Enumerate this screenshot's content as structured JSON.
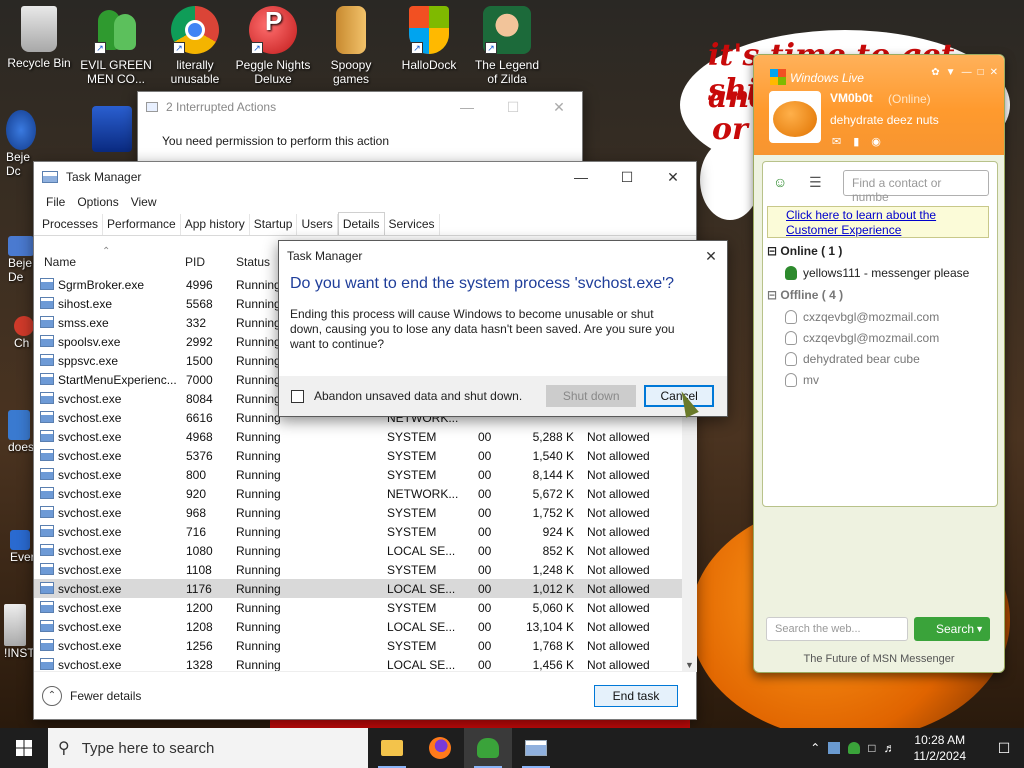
{
  "desktop": {
    "icons": [
      {
        "label": "Recycle Bin"
      },
      {
        "label": "EVIL GREEN MEN CO..."
      },
      {
        "label": "literally unusable"
      },
      {
        "label": "Peggle Nights Deluxe"
      },
      {
        "label": "Spoopy games"
      },
      {
        "label": "HalloDock"
      },
      {
        "label": "The Legend of Zilda"
      }
    ],
    "partial_labels": [
      "Beje Dc",
      "Beje De",
      "Ch De",
      "does",
      "Ever",
      "!INST"
    ],
    "wallpaper_text": [
      "it's time to get shit",
      "and",
      "or t"
    ]
  },
  "interrupted": {
    "title": "2 Interrupted Actions",
    "message": "You need permission to perform this action"
  },
  "taskmgr": {
    "title": "Task Manager",
    "menu": [
      "File",
      "Options",
      "View"
    ],
    "tabs": [
      "Processes",
      "Performance",
      "App history",
      "Startup",
      "Users",
      "Details",
      "Services"
    ],
    "active_tab": "Details",
    "columns": {
      "name": "Name",
      "pid": "PID",
      "status": "Status"
    },
    "rows": [
      {
        "name": "SgrmBroker.exe",
        "pid": "4996",
        "status": "Running",
        "user": "",
        "cpu": "",
        "mem": "",
        "uac": ""
      },
      {
        "name": "sihost.exe",
        "pid": "5568",
        "status": "Running",
        "user": "",
        "cpu": "",
        "mem": "",
        "uac": ""
      },
      {
        "name": "smss.exe",
        "pid": "332",
        "status": "Running",
        "user": "",
        "cpu": "",
        "mem": "",
        "uac": ""
      },
      {
        "name": "spoolsv.exe",
        "pid": "2992",
        "status": "Running",
        "user": "",
        "cpu": "",
        "mem": "",
        "uac": ""
      },
      {
        "name": "sppsvc.exe",
        "pid": "1500",
        "status": "Running",
        "user": "",
        "cpu": "",
        "mem": "",
        "uac": ""
      },
      {
        "name": "StartMenuExperienc...",
        "pid": "7000",
        "status": "Running",
        "user": "",
        "cpu": "",
        "mem": "",
        "uac": ""
      },
      {
        "name": "svchost.exe",
        "pid": "8084",
        "status": "Running",
        "user": "",
        "cpu": "",
        "mem": "",
        "uac": ""
      },
      {
        "name": "svchost.exe",
        "pid": "6616",
        "status": "Running",
        "user": "NETWORK...",
        "cpu": "",
        "mem": "",
        "uac": ""
      },
      {
        "name": "svchost.exe",
        "pid": "4968",
        "status": "Running",
        "user": "SYSTEM",
        "cpu": "00",
        "mem": "5,288 K",
        "uac": "Not allowed"
      },
      {
        "name": "svchost.exe",
        "pid": "5376",
        "status": "Running",
        "user": "SYSTEM",
        "cpu": "00",
        "mem": "1,540 K",
        "uac": "Not allowed"
      },
      {
        "name": "svchost.exe",
        "pid": "800",
        "status": "Running",
        "user": "SYSTEM",
        "cpu": "00",
        "mem": "8,144 K",
        "uac": "Not allowed"
      },
      {
        "name": "svchost.exe",
        "pid": "920",
        "status": "Running",
        "user": "NETWORK...",
        "cpu": "00",
        "mem": "5,672 K",
        "uac": "Not allowed"
      },
      {
        "name": "svchost.exe",
        "pid": "968",
        "status": "Running",
        "user": "SYSTEM",
        "cpu": "00",
        "mem": "1,752 K",
        "uac": "Not allowed"
      },
      {
        "name": "svchost.exe",
        "pid": "716",
        "status": "Running",
        "user": "SYSTEM",
        "cpu": "00",
        "mem": "924 K",
        "uac": "Not allowed"
      },
      {
        "name": "svchost.exe",
        "pid": "1080",
        "status": "Running",
        "user": "LOCAL SE...",
        "cpu": "00",
        "mem": "852 K",
        "uac": "Not allowed"
      },
      {
        "name": "svchost.exe",
        "pid": "1108",
        "status": "Running",
        "user": "SYSTEM",
        "cpu": "00",
        "mem": "1,248 K",
        "uac": "Not allowed"
      },
      {
        "name": "svchost.exe",
        "pid": "1176",
        "status": "Running",
        "user": "LOCAL SE...",
        "cpu": "00",
        "mem": "1,012 K",
        "uac": "Not allowed",
        "selected": true
      },
      {
        "name": "svchost.exe",
        "pid": "1200",
        "status": "Running",
        "user": "SYSTEM",
        "cpu": "00",
        "mem": "5,060 K",
        "uac": "Not allowed"
      },
      {
        "name": "svchost.exe",
        "pid": "1208",
        "status": "Running",
        "user": "LOCAL SE...",
        "cpu": "00",
        "mem": "13,104 K",
        "uac": "Not allowed"
      },
      {
        "name": "svchost.exe",
        "pid": "1256",
        "status": "Running",
        "user": "SYSTEM",
        "cpu": "00",
        "mem": "1,768 K",
        "uac": "Not allowed"
      },
      {
        "name": "svchost.exe",
        "pid": "1328",
        "status": "Running",
        "user": "LOCAL SE...",
        "cpu": "00",
        "mem": "1,456 K",
        "uac": "Not allowed"
      }
    ],
    "fewer_details": "Fewer details",
    "end_task": "End task"
  },
  "dialog": {
    "title": "Task Manager",
    "heading": "Do you want to end the system process 'svchost.exe'?",
    "body": "Ending this process will cause Windows to become unusable or shut down, causing you to lose any data hasn't been saved. Are you sure you want to continue?",
    "checkbox_label": "Abandon unsaved data and shut down.",
    "shutdown_label": "Shut down",
    "cancel_label": "Cancel"
  },
  "msn": {
    "brand": "Windows Live",
    "username": "VM0b0t",
    "status": "(Online)",
    "personal_message": "dehydrate deez nuts",
    "search_placeholder": "Find a contact or numbe",
    "ad_text": "Click here to learn about the Customer Experience",
    "online_group": "Online ( 1 )",
    "online_contacts": [
      "yellows111 - messenger please"
    ],
    "offline_group": "Offline ( 4 )",
    "offline_contacts": [
      "cxzqevbgl@mozmail.com",
      "cxzqevbgl@mozmail.com",
      "dehydrated bear cube",
      "mv"
    ],
    "web_placeholder": "Search the web...",
    "search_button": "Search",
    "tagline": "The Future of MSN Messenger"
  },
  "taskbar": {
    "search_placeholder": "Type here to search",
    "time": "10:28 AM",
    "date": "11/2/2024"
  },
  "colors": {
    "accent": "#0078d7",
    "dialog_heading": "#1f3e9a",
    "msn_orange": "#ff9a2e",
    "msn_green": "#3aa33a",
    "taskbar": "#1e1e1e"
  }
}
